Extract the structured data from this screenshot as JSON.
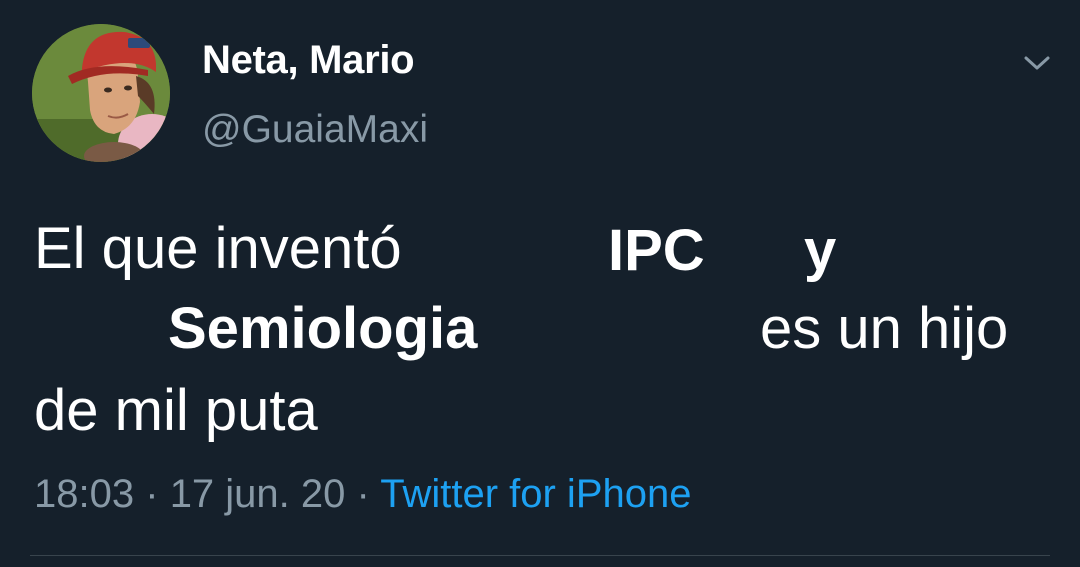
{
  "tweet": {
    "author": {
      "display_name": "Neta, Mario",
      "handle": "@GuaiaMaxi"
    },
    "text_segments": [
      {
        "text": "El que inventó",
        "bold": false
      },
      {
        "text": "IPC",
        "bold": true
      },
      {
        "text": "y",
        "bold": true
      },
      {
        "text": "Semiologia",
        "bold": true
      },
      {
        "text": "es un hijo",
        "bold": false
      },
      {
        "text": "de mil puta",
        "bold": false
      }
    ],
    "meta": {
      "time": "18:03",
      "separator": "·",
      "date": "17 jun. 20",
      "source": "Twitter for iPhone"
    }
  },
  "colors": {
    "background": "#15202b",
    "text": "#ffffff",
    "secondary_text": "#8899a6",
    "link": "#1da1f2",
    "divider": "#38444d"
  },
  "icons": {
    "more": "chevron-down-icon"
  }
}
